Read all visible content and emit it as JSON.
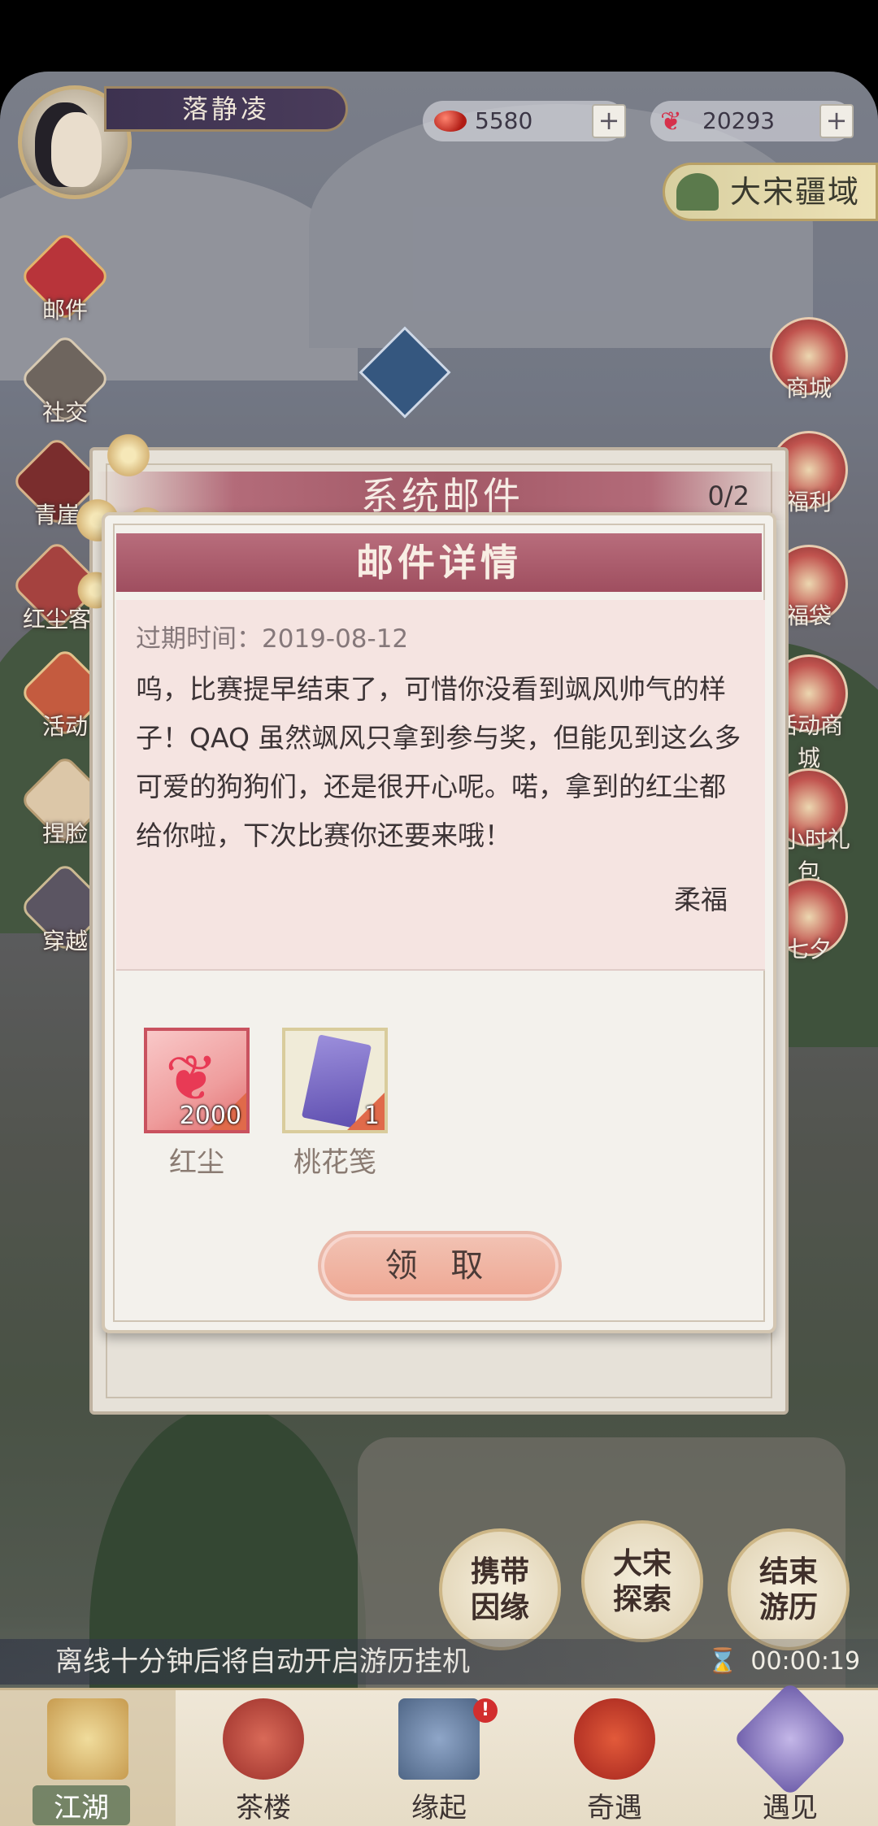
{
  "player": {
    "name": "落静凌"
  },
  "resources": {
    "gems": "5580",
    "butterflies": "20293",
    "plus": "+"
  },
  "region_button": "大宋疆域",
  "left_menu": [
    {
      "label": "邮件"
    },
    {
      "label": "社交"
    },
    {
      "label": "青崖"
    },
    {
      "label": "红尘客"
    },
    {
      "label": "活动"
    },
    {
      "label": "捏脸"
    },
    {
      "label": "穿越"
    }
  ],
  "right_menu": [
    {
      "label": "商城"
    },
    {
      "label": "福利"
    },
    {
      "label": "福袋"
    },
    {
      "label": "活动商城"
    },
    {
      "label": "5小时礼包"
    },
    {
      "label": "七夕"
    }
  ],
  "mail_panel": {
    "title": "系统邮件",
    "count": "0/2",
    "detail_title": "邮件详情",
    "expire_label": "过期时间：",
    "expire_date": "2019-08-12",
    "body": "呜，比赛提早结束了，可惜你没看到飒风帅气的样子！QAQ 虽然飒风只拿到参与奖，但能见到这么多可爱的狗狗们，还是很开心呢。喏，拿到的红尘都给你啦，下次比赛你还要来哦！",
    "sender": "柔福",
    "rewards": [
      {
        "name": "红尘",
        "qty": "2000"
      },
      {
        "name": "桃花笺",
        "qty": "1"
      }
    ],
    "claim_button": "领 取"
  },
  "action_buttons": [
    {
      "label": "携带\n因缘"
    },
    {
      "label": "大宋\n探索"
    },
    {
      "label": "结束\n游历"
    }
  ],
  "hint": "离线十分钟后将自动开启游历挂机",
  "timer": "00:00:19",
  "timer_icon": "⌛",
  "bottom_nav": [
    {
      "label": "江湖",
      "active": true
    },
    {
      "label": "茶楼"
    },
    {
      "label": "缘起"
    },
    {
      "label": "奇遇"
    },
    {
      "label": "遇见"
    }
  ],
  "colors": {
    "accent": "#a25866",
    "panel_bg": "#f3f1ec",
    "mail_bg": "#f5e4e1",
    "claim": "#eea793"
  },
  "icons": {
    "gem": "red-gem-icon",
    "butterfly": "butterfly-icon",
    "sword": "crossed-swords-icon",
    "hourglass": "hourglass-icon"
  }
}
